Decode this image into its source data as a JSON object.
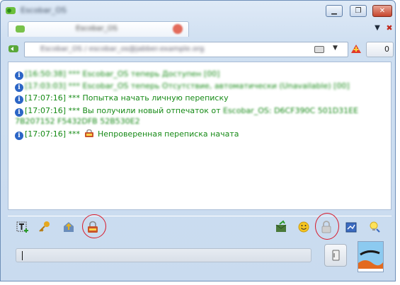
{
  "window": {
    "title": "Escobar_OS",
    "min_glyph": "▁",
    "max_glyph": "❐",
    "close_glyph": "✕"
  },
  "tab": {
    "label": "Escobar_OS",
    "menu_glyph": "▼",
    "close_glyph": "✖"
  },
  "contact": {
    "value": "Escobar_OS / escobar_os@jabber.example.org",
    "dropdown_glyph": "▼",
    "counter": "0"
  },
  "chat": {
    "messages": [
      {
        "time": "[16:50:38]",
        "text": "*** Escobar_OS теперь Доступен [00]"
      },
      {
        "time": "[17:03:03]",
        "text": "*** Escobar_OS теперь Отсутствие, автоматически (Unavailable) [00]"
      },
      {
        "time": "[17:07:16]",
        "text": "*** Попытка начать личную переписку"
      },
      {
        "time": "[17:07:16]",
        "text": "*** Вы получили новый отпечаток от",
        "fingerprint_owner": "Escobar_OS:",
        "fingerprint_line1": "D6CF390C 501D31EE",
        "fingerprint_line2": "7B207152 F5432DFB 52B530E2"
      },
      {
        "time": "[17:07:16]",
        "text": "***",
        "text_after_icon": "Непроверенная переписка начата"
      }
    ]
  },
  "toolbar": {
    "icons": [
      "insert-text-icon",
      "key-icon",
      "send-file-icon",
      "otr-icon",
      "history-icon",
      "emoticon-icon",
      "encryption-lock-icon",
      "chat-settings-icon",
      "notify-bulb-icon"
    ]
  },
  "input": {
    "value": ""
  },
  "colors": {
    "message_green": "#168a16",
    "info_blue": "#2b65c6",
    "highlight_red": "#d8182a"
  }
}
